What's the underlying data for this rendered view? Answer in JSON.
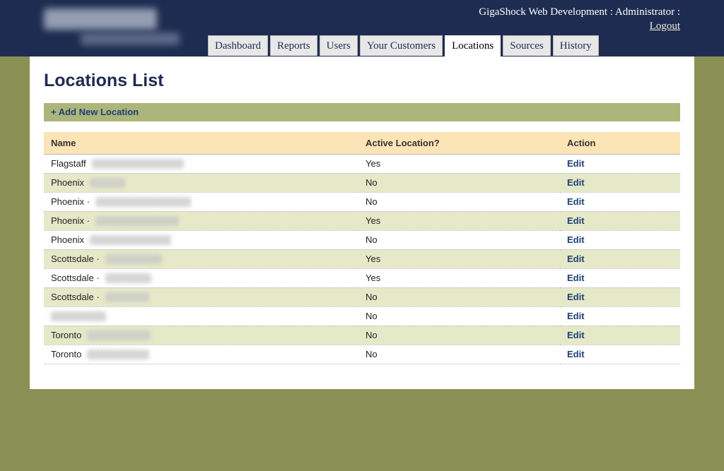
{
  "header": {
    "user_line": "GigaShock Web Development : Administrator :",
    "logout_label": "Logout"
  },
  "tabs": [
    {
      "label": "Dashboard"
    },
    {
      "label": "Reports"
    },
    {
      "label": "Users"
    },
    {
      "label": "Your Customers"
    },
    {
      "label": "Locations",
      "active": true
    },
    {
      "label": "Sources"
    },
    {
      "label": "History"
    }
  ],
  "page": {
    "title": "Locations List",
    "add_label": "+ Add New Location"
  },
  "table": {
    "columns": [
      "Name",
      "Active Location?",
      "Action"
    ],
    "rows": [
      {
        "name": "Flagstaff",
        "active": "Yes",
        "action": "Edit"
      },
      {
        "name": "Phoenix",
        "active": "No",
        "action": "Edit"
      },
      {
        "name": "Phoenix ·",
        "active": "No",
        "action": "Edit"
      },
      {
        "name": "Phoenix ·",
        "active": "Yes",
        "action": "Edit"
      },
      {
        "name": "Phoenix",
        "active": "No",
        "action": "Edit"
      },
      {
        "name": "Scottsdale ·",
        "active": "Yes",
        "action": "Edit"
      },
      {
        "name": "Scottsdale ·",
        "active": "Yes",
        "action": "Edit"
      },
      {
        "name": "Scottsdale ·",
        "active": "No",
        "action": "Edit"
      },
      {
        "name": "",
        "active": "No",
        "action": "Edit"
      },
      {
        "name": "Toronto",
        "active": "No",
        "action": "Edit"
      },
      {
        "name": "Toronto",
        "active": "No",
        "action": "Edit"
      }
    ]
  },
  "colors": {
    "header_bg": "#1d2c50",
    "page_bg": "#8a8f54",
    "add_bar_bg": "#adb57a",
    "table_header_bg": "#fce4b6",
    "alt_row_bg": "#e6e9c8",
    "link_color": "#1d3f76"
  }
}
